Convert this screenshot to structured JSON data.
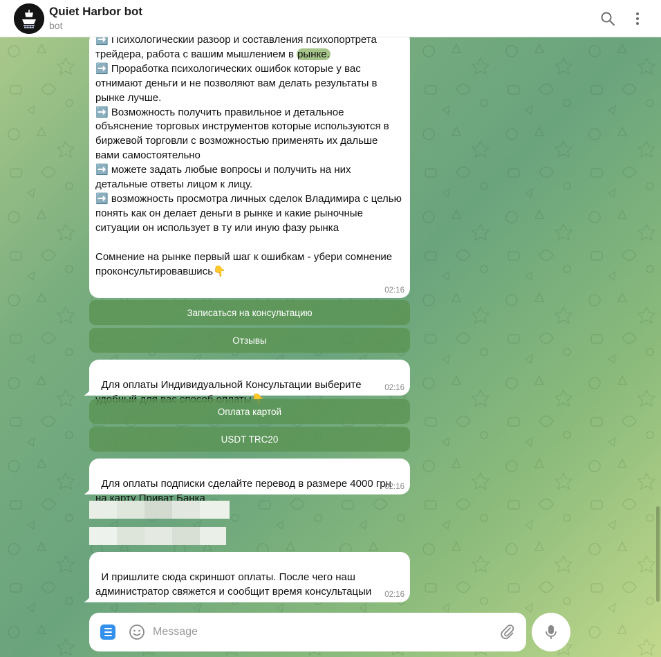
{
  "header": {
    "title": "Quiet Harbor bot",
    "subtitle": "bot",
    "search_icon": "search-icon",
    "more_icon": "more-vertical-icon"
  },
  "messages": [
    {
      "text_before": "➡️ Психологический разбор и составления психопортрета трейдера, работа с вашим мышлением в ",
      "highlight": "рынке.",
      "text_after": "\n➡️ Проработка психологических ошибок которые у вас отнимают деньги и не позволяют вам делать результаты в рынке лучше.\n➡️ Возможность получить правильное и детальное объяснение торговых инструментов которые используются в биржевой торговли с возможностью применять их дальше вами самостоятельно\n➡️ можете задать любые вопросы и получить на них детальные ответы лицом к лицу.\n➡️ возможность просмотра личных сделок Владимира с целью понять как он делает деньги в рынке и какие рыночные ситуации он использует в ту или иную фазу рынка\n\nСомнение на рынке первый шаг к ошибкам - убери сомнение проконсультировавшись👇",
      "time": "02:16"
    },
    {
      "text": "Для оплаты Индивидуальной Консультации выберите удобный для вас способ оплаты👇",
      "time": "02:16"
    },
    {
      "text": "Для оплаты подписки сделайте перевод в размере 4000 грн на карту Приват Банка",
      "time": "02:16"
    },
    {
      "text": "И пришлите сюда скриншот оплаты. После чего наш администратор свяжется и сообщит время консультацыи",
      "time": "02:16"
    }
  ],
  "keyboards": {
    "consult": [
      "Записаться на консультацию",
      "Отзывы"
    ],
    "payment": [
      "Оплата картой",
      "USDT TRC20"
    ]
  },
  "composer": {
    "placeholder": "Message",
    "menu_icon": "menu-icon",
    "emoji_icon": "emoji-icon",
    "attach_icon": "paperclip-icon",
    "mic_icon": "microphone-icon"
  },
  "colors": {
    "accent": "#3390ec",
    "inline_button": "#5c9454",
    "bubble": "#ffffff",
    "time": "#8b8b8b"
  }
}
